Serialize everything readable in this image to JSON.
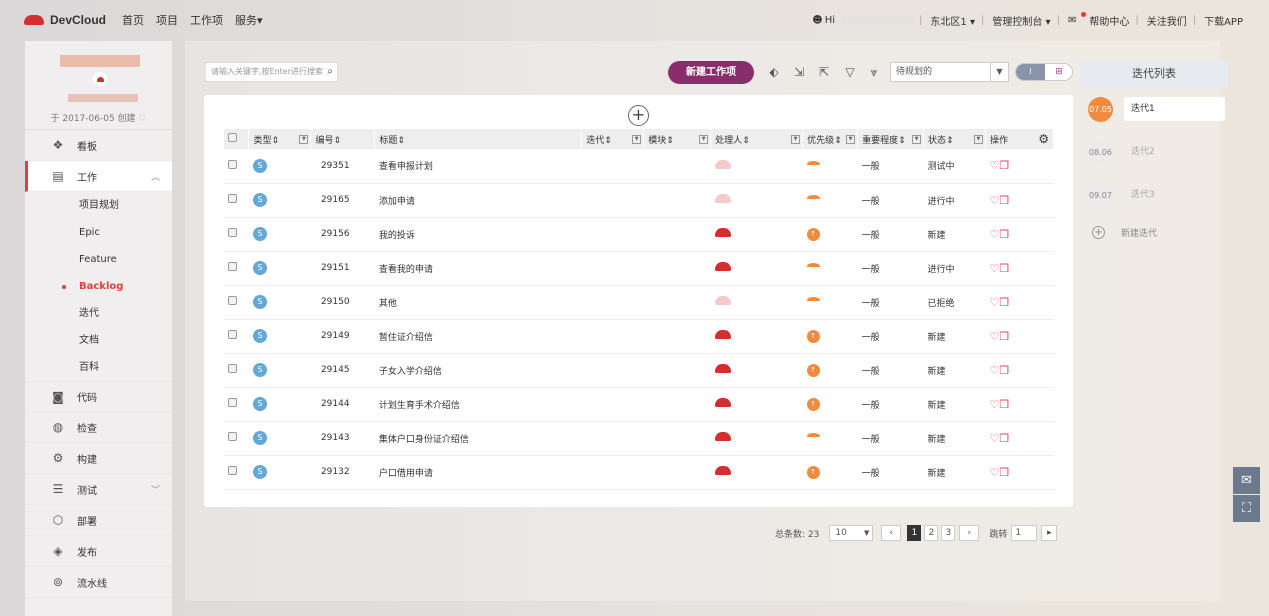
{
  "topbar": {
    "brand": "DevCloud",
    "nav": [
      "首页",
      "项目",
      "工作项",
      "服务▾"
    ],
    "greeting": "Hi",
    "region": "东北区1",
    "console": "管理控制台",
    "help": "帮助中心",
    "follow": "关注我们",
    "download": "下载APP"
  },
  "sidebar": {
    "since": "于 2017-06-05 创建",
    "menu": {
      "board": "看板",
      "work": "工作",
      "code": "代码",
      "check": "检查",
      "build": "构建",
      "test": "测试",
      "deploy": "部署",
      "release": "发布",
      "pipeline": "流水线"
    },
    "work_sub": [
      "项目规划",
      "Epic",
      "Feature",
      "Backlog",
      "迭代",
      "文档",
      "百科"
    ]
  },
  "toolbar": {
    "search_placeholder": "请输入关键字,按Enter进行搜索",
    "new_button": "新建工作项",
    "filter_value": "待规划的"
  },
  "table": {
    "headers": [
      "类型",
      "编号",
      "标题",
      "迭代",
      "模块",
      "处理人",
      "优先级",
      "重要程度",
      "状态",
      "操作"
    ],
    "rows": [
      {
        "type": "S",
        "id": "29351",
        "title": "查看申报计划",
        "importance": "一般",
        "status": "测试中"
      },
      {
        "type": "S",
        "id": "29165",
        "title": "添加申请",
        "importance": "一般",
        "status": "进行中"
      },
      {
        "type": "S",
        "id": "29156",
        "title": "我的投诉",
        "importance": "一般",
        "status": "新建"
      },
      {
        "type": "S",
        "id": "29151",
        "title": "查看我的申请",
        "importance": "一般",
        "status": "进行中"
      },
      {
        "type": "S",
        "id": "29150",
        "title": "其他",
        "importance": "一般",
        "status": "已拒绝"
      },
      {
        "type": "S",
        "id": "29149",
        "title": "暂住证介绍信",
        "importance": "一般",
        "status": "新建"
      },
      {
        "type": "S",
        "id": "29145",
        "title": "子女入学介绍信",
        "importance": "一般",
        "status": "新建"
      },
      {
        "type": "S",
        "id": "29144",
        "title": "计划生育手术介绍信",
        "importance": "一般",
        "status": "新建"
      },
      {
        "type": "S",
        "id": "29143",
        "title": "集体户口身份证介绍信",
        "importance": "一般",
        "status": "新建"
      },
      {
        "type": "S",
        "id": "29132",
        "title": "户口借用申请",
        "importance": "一般",
        "status": "新建"
      }
    ]
  },
  "pager": {
    "total_label": "总条数: 23",
    "page_size": "10",
    "pages": [
      "1",
      "2",
      "3"
    ],
    "jump_label": "跳转",
    "jump_value": "1"
  },
  "iterations": {
    "title": "迭代列表",
    "items": [
      {
        "date": "07.05",
        "name": "迭代1"
      },
      {
        "date": "08.06",
        "name": "迭代2"
      },
      {
        "date": "09.07",
        "name": "迭代3"
      }
    ],
    "new_label": "新建迭代"
  }
}
